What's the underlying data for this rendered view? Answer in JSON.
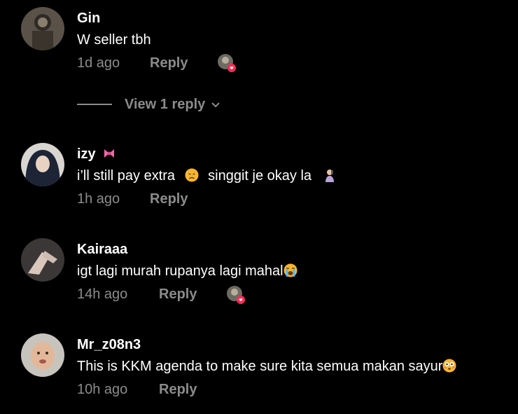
{
  "comments": [
    {
      "username": "Gin",
      "text": "W seller tbh",
      "time": "1d ago",
      "reply_label": "Reply",
      "view_replies_label": "View 1 reply"
    },
    {
      "username": "izy",
      "text_before": "i’ll still pay extra",
      "text_after": "singgit je okay la",
      "time": "1h ago",
      "reply_label": "Reply"
    },
    {
      "username": "Kairaaa",
      "text": "igt lagi murah rupanya lagi mahal",
      "time": "14h ago",
      "reply_label": "Reply"
    },
    {
      "username": "Mr_z08n3",
      "text": "This is KKM agenda to make sure kita semua makan sayur",
      "time": "10h ago",
      "reply_label": "Reply"
    }
  ],
  "colors": {
    "background": "#000000",
    "username": "#ffffff",
    "meta": "#8b8b8b",
    "like_badge": "#fe2c55"
  },
  "icons": {
    "creator_liked": "creator-liked-badge-icon",
    "chevron": "chevron-down-icon",
    "disappointed": "disappointed-face-emoji",
    "crying": "crying-face-emoji",
    "flushed": "flushed-face-emoji",
    "ribbon": "pink-ribbon-emoji",
    "phone_woman": "woman-on-phone-emoji"
  }
}
